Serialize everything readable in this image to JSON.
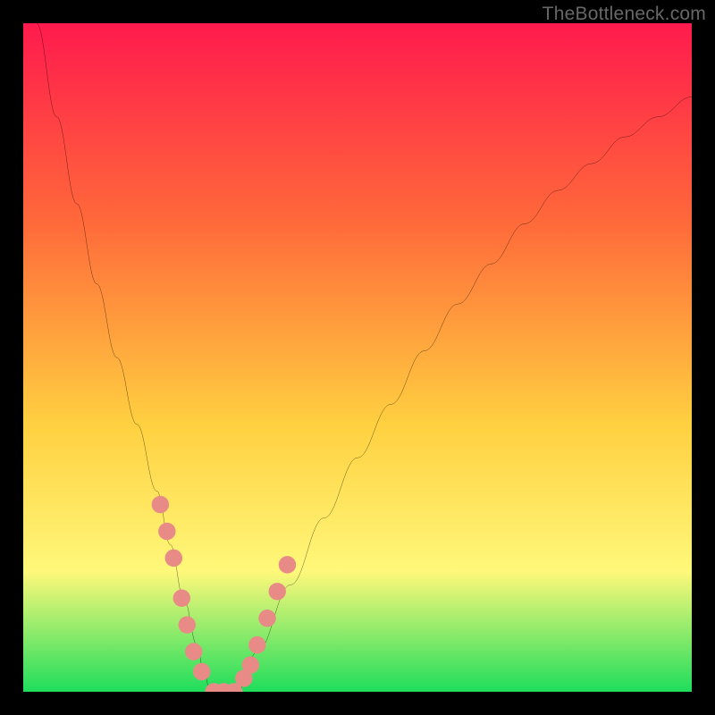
{
  "attribution": "TheBottleneck.com",
  "chart_data": {
    "type": "line",
    "title": "",
    "xlabel": "",
    "ylabel": "",
    "xlim": [
      0,
      100
    ],
    "ylim": [
      0,
      100
    ],
    "background": {
      "gradient_colors": [
        "#ff1a4d",
        "#ff6a3a",
        "#ffd040",
        "#fff87a",
        "#1fdd5c"
      ],
      "gradient_stops": [
        0,
        30,
        60,
        82,
        100
      ]
    },
    "left_curve": {
      "points_x": [
        2,
        5,
        8,
        11,
        14,
        17,
        20,
        22,
        24,
        26,
        27,
        28
      ],
      "points_y": [
        100,
        86,
        73,
        61,
        50,
        40,
        30,
        22,
        14,
        7,
        3,
        0
      ]
    },
    "right_curve": {
      "points_x": [
        32,
        35,
        40,
        45,
        50,
        55,
        60,
        65,
        70,
        75,
        80,
        85,
        90,
        95,
        100
      ],
      "points_y": [
        0,
        6,
        16,
        26,
        35,
        43,
        51,
        58,
        64,
        70,
        75,
        79,
        83,
        86,
        89
      ]
    },
    "flat_bottom": {
      "x_start": 28,
      "x_end": 32,
      "y": 0
    },
    "markers_left": {
      "x": [
        20.5,
        21.5,
        22.5,
        23.7,
        24.5,
        25.5,
        26.7
      ],
      "y": [
        28,
        24,
        20,
        14,
        10,
        6,
        3
      ]
    },
    "markers_right": {
      "x": [
        33,
        34,
        35,
        36.5,
        38,
        39.5
      ],
      "y": [
        2,
        4,
        7,
        11,
        15,
        19
      ]
    },
    "markers_bottom": {
      "x": [
        28.5,
        30,
        31.5
      ],
      "y": [
        0,
        0,
        0
      ]
    },
    "marker_color": "#e88b87",
    "curve_color": "#000000",
    "curve_width": 2.2
  }
}
